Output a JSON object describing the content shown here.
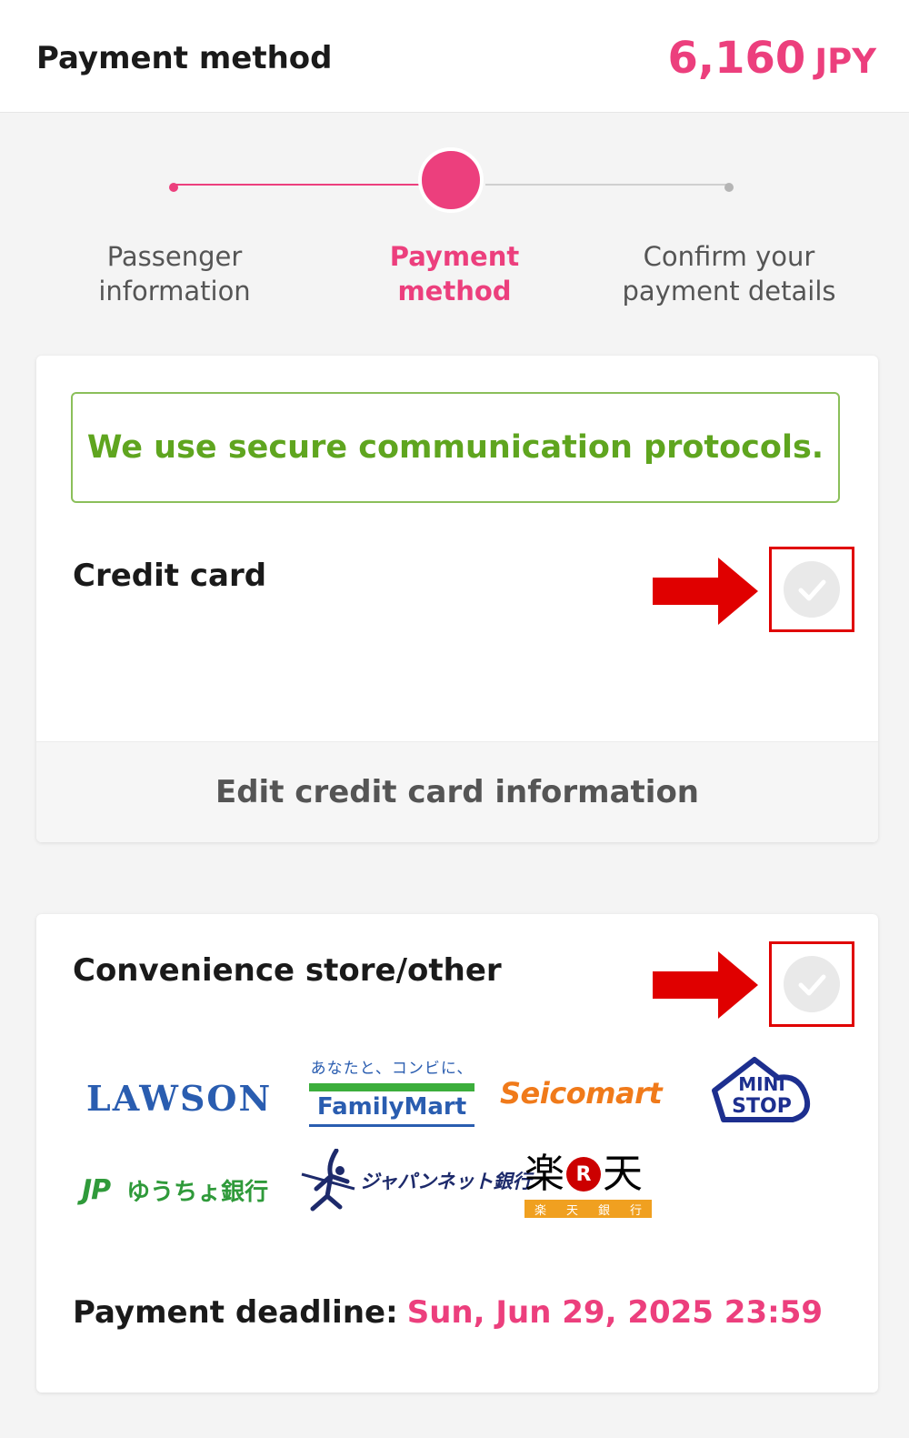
{
  "header": {
    "title": "Payment method",
    "price_amount": "6,160",
    "price_currency": "JPY"
  },
  "stepper": {
    "steps": [
      {
        "label_line1": "Passenger",
        "label_line2": "information",
        "state": "done"
      },
      {
        "label_line1": "Payment method",
        "label_line2": "",
        "state": "current"
      },
      {
        "label_line1": "Confirm your",
        "label_line2": "payment details",
        "state": "todo"
      }
    ]
  },
  "credit_card": {
    "secure_notice": "We use secure communication protocols.",
    "title": "Credit card",
    "edit_label": "Edit credit card information",
    "selected": false
  },
  "convenience": {
    "title": "Convenience store/other",
    "selected": false,
    "logos": {
      "lawson": "LAWSON",
      "familymart_tagline": "あなたと、コンビに、",
      "familymart_name": "FamilyMart",
      "seicomart": "Seicomart",
      "ministop_line1": "MINI",
      "ministop_line2": "STOP",
      "yucho_mark": "JP",
      "yucho_name": "ゆうちょ銀行",
      "japannet": "ジャパンネット銀行",
      "rakuten_left": "楽",
      "rakuten_badge": "R",
      "rakuten_right": "天",
      "rakuten_sub": [
        "楽",
        "天",
        "銀",
        "行"
      ]
    },
    "deadline_label": "Payment deadline:",
    "deadline_value": "Sun, Jun 29, 2025 23:59"
  },
  "colors": {
    "accent_pink": "#ec3f7d",
    "secure_green": "#5fa51f",
    "annotation_red": "#e00000"
  }
}
